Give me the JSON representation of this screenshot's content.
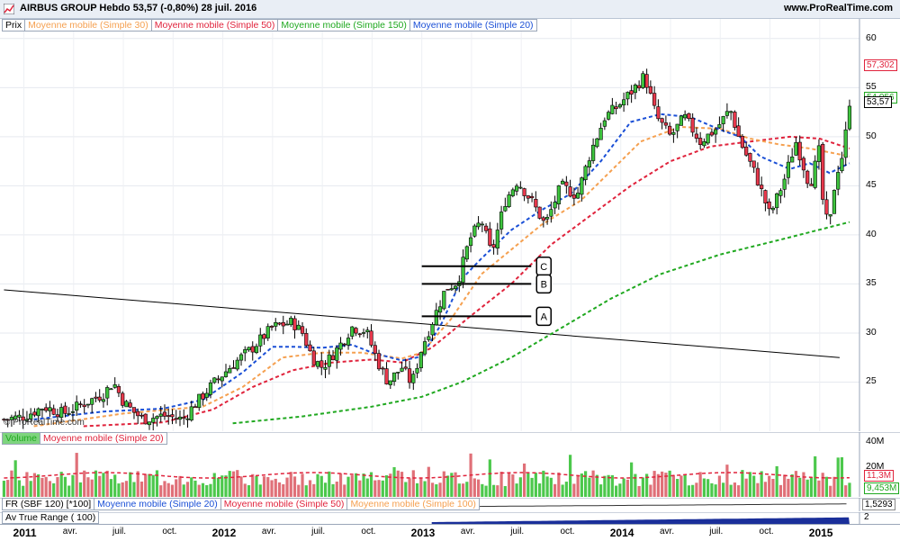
{
  "window": {
    "title": "AIRBUS GROUP   Hebdo    53,57 (-0,80%)    28 juil. 2016",
    "site": "www.ProRealTime.com",
    "watermark": "© ProRealTime.com"
  },
  "price_panel": {
    "legend": [
      {
        "label": "Prix",
        "color": "#000000"
      },
      {
        "label": "Moyenne mobile (Simple 30)",
        "color": "#f5a050"
      },
      {
        "label": "Moyenne mobile (Simple 50)",
        "color": "#e0233c"
      },
      {
        "label": "Moyenne mobile (Simple 150)",
        "color": "#1fa81f"
      },
      {
        "label": "Moyenne mobile (Simple 20)",
        "color": "#1a4fd6"
      }
    ],
    "y_ticks": [
      "60",
      "55",
      "50",
      "45",
      "40",
      "35",
      "30",
      "25"
    ],
    "value_tags": [
      {
        "label": "57,302",
        "color": "#e0233c"
      },
      {
        "label": "54,056",
        "color": "#1fa81f"
      },
      {
        "label": "53,57",
        "color": "#000000"
      }
    ],
    "annotations": [
      "C",
      "B",
      "A"
    ]
  },
  "volume_panel": {
    "legend": [
      {
        "label": "Volume",
        "color": "#1fa81f"
      },
      {
        "label": "Moyenne mobile (Simple 20)",
        "color": "#e0233c"
      }
    ],
    "y_ticks": [
      "40M",
      "20M"
    ],
    "value_tags": [
      {
        "label": "11,3M",
        "color": "#e0233c"
      },
      {
        "label": "9,453M",
        "color": "#1fa81f"
      }
    ]
  },
  "fr_panel": {
    "legend": [
      {
        "label": "FR (SBF 120) [*100]",
        "color": "#000000"
      },
      {
        "label": "Moyenne mobile (Simple 20)",
        "color": "#1a4fd6"
      },
      {
        "label": "Moyenne mobile (Simple 50)",
        "color": "#e0233c"
      },
      {
        "label": "Moyenne mobile (Simple 100)",
        "color": "#f5a050"
      }
    ],
    "value_tag": "1,5293"
  },
  "atr_panel": {
    "legend": [
      {
        "label": "Av True Range ( 100)",
        "color": "#000000"
      }
    ],
    "value_tag": "2"
  },
  "x_axis": {
    "labels": [
      {
        "text": "2011",
        "bold": true
      },
      {
        "text": "avr.",
        "bold": false
      },
      {
        "text": "juil.",
        "bold": false
      },
      {
        "text": "oct.",
        "bold": false
      },
      {
        "text": "2012",
        "bold": true
      },
      {
        "text": "avr.",
        "bold": false
      },
      {
        "text": "juil.",
        "bold": false
      },
      {
        "text": "oct.",
        "bold": false
      },
      {
        "text": "2013",
        "bold": true
      },
      {
        "text": "avr.",
        "bold": false
      },
      {
        "text": "juil.",
        "bold": false
      },
      {
        "text": "oct.",
        "bold": false
      },
      {
        "text": "2014",
        "bold": true
      },
      {
        "text": "avr.",
        "bold": false
      },
      {
        "text": "juil.",
        "bold": false
      },
      {
        "text": "oct.",
        "bold": false
      },
      {
        "text": "2015",
        "bold": true
      }
    ]
  },
  "chart_data": {
    "type": "candlestick",
    "ylim": [
      20,
      62
    ],
    "trendline": {
      "from": [
        2010.9,
        34.4
      ],
      "to": [
        2015.1,
        27.5
      ]
    },
    "levels": [
      {
        "label": "C",
        "value": 36.8,
        "x_from": 2013.0,
        "x_to": 2013.55
      },
      {
        "label": "B",
        "value": 35.0,
        "x_from": 2013.0,
        "x_to": 2013.55
      },
      {
        "label": "A",
        "value": 31.7,
        "x_from": 2013.0,
        "x_to": 2013.55
      }
    ],
    "price_path": [
      [
        2010.9,
        21.2
      ],
      [
        2011.0,
        21.5
      ],
      [
        2011.1,
        22.5
      ],
      [
        2011.2,
        21.8
      ],
      [
        2011.3,
        22.8
      ],
      [
        2011.4,
        23.8
      ],
      [
        2011.45,
        25.0
      ],
      [
        2011.5,
        23.0
      ],
      [
        2011.55,
        22.0
      ],
      [
        2011.6,
        21.2
      ],
      [
        2011.7,
        21.6
      ],
      [
        2011.8,
        21.2
      ],
      [
        2011.85,
        22.5
      ],
      [
        2011.95,
        24.8
      ],
      [
        2012.05,
        26.8
      ],
      [
        2012.15,
        28.5
      ],
      [
        2012.25,
        30.6
      ],
      [
        2012.35,
        31.1
      ],
      [
        2012.4,
        30.0
      ],
      [
        2012.45,
        27.5
      ],
      [
        2012.5,
        26.5
      ],
      [
        2012.58,
        28.5
      ],
      [
        2012.65,
        30.6
      ],
      [
        2012.72,
        30.2
      ],
      [
        2012.78,
        27.0
      ],
      [
        2012.83,
        25.0
      ],
      [
        2012.9,
        26.5
      ],
      [
        2012.95,
        24.8
      ],
      [
        2013.0,
        28.5
      ],
      [
        2013.05,
        31.0
      ],
      [
        2013.12,
        34.5
      ],
      [
        2013.18,
        35.2
      ],
      [
        2013.24,
        39.5
      ],
      [
        2013.3,
        41.5
      ],
      [
        2013.35,
        38.0
      ],
      [
        2013.42,
        43.5
      ],
      [
        2013.48,
        45.5
      ],
      [
        2013.55,
        43.5
      ],
      [
        2013.62,
        41.0
      ],
      [
        2013.7,
        45.0
      ],
      [
        2013.78,
        44.0
      ],
      [
        2013.85,
        48.5
      ],
      [
        2013.92,
        52.0
      ],
      [
        2013.98,
        53.0
      ],
      [
        2014.05,
        54.5
      ],
      [
        2014.12,
        56.2
      ],
      [
        2014.18,
        52.0
      ],
      [
        2014.25,
        50.0
      ],
      [
        2014.32,
        52.0
      ],
      [
        2014.4,
        49.5
      ],
      [
        2014.48,
        50.8
      ],
      [
        2014.55,
        52.8
      ],
      [
        2014.6,
        49.5
      ],
      [
        2014.68,
        46.0
      ],
      [
        2014.75,
        42.0
      ],
      [
        2014.82,
        45.5
      ],
      [
        2014.88,
        49.5
      ],
      [
        2014.95,
        45.0
      ],
      [
        2015.0,
        48.8
      ],
      [
        2015.02,
        42.0
      ],
      [
        2015.05,
        41.0
      ],
      [
        2015.08,
        46.0
      ],
      [
        2015.12,
        48.5
      ],
      [
        2015.15,
        53.6
      ]
    ],
    "ma20": [
      [
        2011.05,
        21.2
      ],
      [
        2011.4,
        22.0
      ],
      [
        2011.7,
        22.3
      ],
      [
        2011.9,
        23.2
      ],
      [
        2012.1,
        26.0
      ],
      [
        2012.25,
        28.6
      ],
      [
        2012.35,
        28.6
      ],
      [
        2012.5,
        28.5
      ],
      [
        2012.65,
        28.8
      ],
      [
        2012.75,
        28.0
      ],
      [
        2012.9,
        27.2
      ],
      [
        2013.0,
        27.6
      ],
      [
        2013.1,
        31.0
      ],
      [
        2013.2,
        35.5
      ],
      [
        2013.3,
        37.6
      ],
      [
        2013.45,
        40.5
      ],
      [
        2013.6,
        42.5
      ],
      [
        2013.75,
        44.2
      ],
      [
        2013.9,
        47.5
      ],
      [
        2014.05,
        51.5
      ],
      [
        2014.2,
        52.3
      ],
      [
        2014.35,
        52.0
      ],
      [
        2014.5,
        50.7
      ],
      [
        2014.6,
        50.0
      ],
      [
        2014.7,
        48.0
      ],
      [
        2014.85,
        46.7
      ],
      [
        2014.95,
        47.3
      ],
      [
        2015.05,
        46.3
      ],
      [
        2015.15,
        47.3
      ]
    ],
    "ma30": [
      [
        2011.05,
        20.5
      ],
      [
        2011.5,
        21.8
      ],
      [
        2011.9,
        22.5
      ],
      [
        2012.1,
        24.5
      ],
      [
        2012.3,
        27.5
      ],
      [
        2012.5,
        28.0
      ],
      [
        2012.7,
        28.0
      ],
      [
        2012.9,
        27.4
      ],
      [
        2013.0,
        28.0
      ],
      [
        2013.15,
        31.5
      ],
      [
        2013.3,
        36.0
      ],
      [
        2013.45,
        38.5
      ],
      [
        2013.6,
        41.0
      ],
      [
        2013.8,
        43.5
      ],
      [
        2013.95,
        46.5
      ],
      [
        2014.1,
        49.5
      ],
      [
        2014.3,
        51.0
      ],
      [
        2014.5,
        50.8
      ],
      [
        2014.65,
        49.8
      ],
      [
        2014.8,
        49.2
      ],
      [
        2014.95,
        48.8
      ],
      [
        2015.15,
        48.0
      ]
    ],
    "ma50": [
      [
        2011.3,
        20.5
      ],
      [
        2011.7,
        20.9
      ],
      [
        2011.95,
        22.2
      ],
      [
        2012.15,
        24.5
      ],
      [
        2012.35,
        26.2
      ],
      [
        2012.55,
        27.0
      ],
      [
        2012.75,
        27.3
      ],
      [
        2012.9,
        27.0
      ],
      [
        2013.05,
        28.5
      ],
      [
        2013.25,
        31.8
      ],
      [
        2013.45,
        35.0
      ],
      [
        2013.65,
        39.0
      ],
      [
        2013.85,
        42.0
      ],
      [
        2014.05,
        45.0
      ],
      [
        2014.25,
        47.5
      ],
      [
        2014.45,
        49.0
      ],
      [
        2014.65,
        49.5
      ],
      [
        2014.85,
        50.0
      ],
      [
        2015.0,
        49.8
      ],
      [
        2015.15,
        48.8
      ]
    ],
    "ma150": [
      [
        2012.05,
        20.8
      ],
      [
        2012.4,
        21.5
      ],
      [
        2012.75,
        22.5
      ],
      [
        2013.0,
        23.5
      ],
      [
        2013.2,
        25.0
      ],
      [
        2013.45,
        27.5
      ],
      [
        2013.7,
        30.5
      ],
      [
        2013.95,
        33.5
      ],
      [
        2014.2,
        36.0
      ],
      [
        2014.5,
        38.0
      ],
      [
        2014.8,
        39.5
      ],
      [
        2015.15,
        41.3
      ]
    ]
  }
}
